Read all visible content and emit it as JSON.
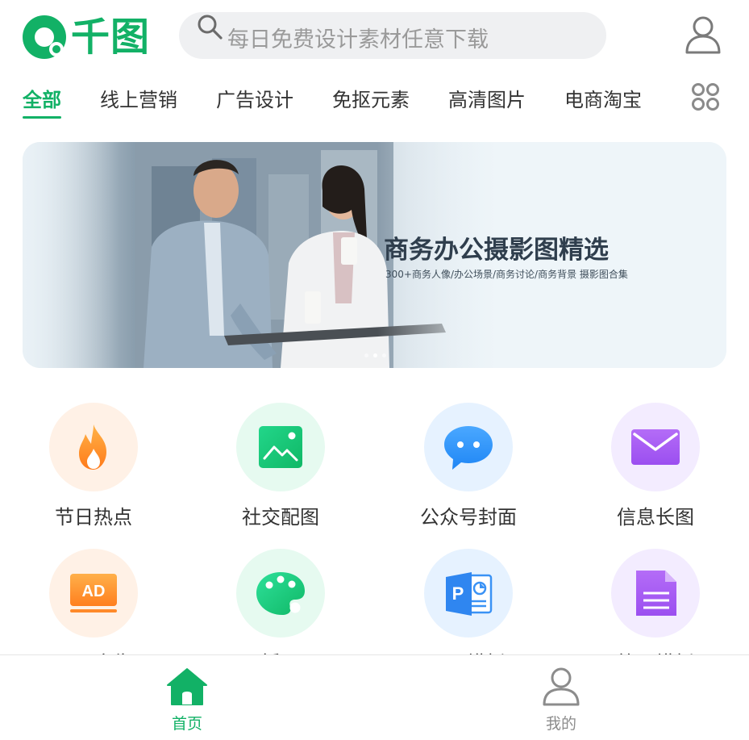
{
  "app": {
    "logo_text": "千图",
    "brand_color": "#12b166"
  },
  "search": {
    "placeholder": "每日免费设计素材任意下载"
  },
  "tabs": [
    {
      "label": "全部",
      "active": true
    },
    {
      "label": "线上营销",
      "active": false
    },
    {
      "label": "广告设计",
      "active": false
    },
    {
      "label": "免抠元素",
      "active": false
    },
    {
      "label": "高清图片",
      "active": false
    },
    {
      "label": "电商淘宝",
      "active": false
    }
  ],
  "banner": {
    "title": "商务办公摄影图精选",
    "subtitle": "300+商务人像/办公场景/商务讨论/商务背景 摄影图合集",
    "slide_count": 3,
    "active_slide": 2
  },
  "categories": [
    {
      "label": "节日热点",
      "icon": "flame-icon",
      "bg": "#fff1e6"
    },
    {
      "label": "社交配图",
      "icon": "image-icon",
      "bg": "#e6faf0"
    },
    {
      "label": "公众号封面",
      "icon": "chat-bubble-icon",
      "bg": "#e6f2ff"
    },
    {
      "label": "信息长图",
      "icon": "envelope-icon",
      "bg": "#f3ecff"
    },
    {
      "label": "平面广告",
      "icon": "ad-icon",
      "bg": "#fff1e6"
    },
    {
      "label": "插画",
      "icon": "palette-icon",
      "bg": "#e6faf0"
    },
    {
      "label": "PPT模板",
      "icon": "ppt-icon",
      "bg": "#e6f2ff"
    },
    {
      "label": "简历模板",
      "icon": "document-icon",
      "bg": "#f3ecff"
    }
  ],
  "bottom_nav": [
    {
      "label": "首页",
      "icon": "home-icon",
      "active": true
    },
    {
      "label": "我的",
      "icon": "user-icon",
      "active": false
    }
  ]
}
